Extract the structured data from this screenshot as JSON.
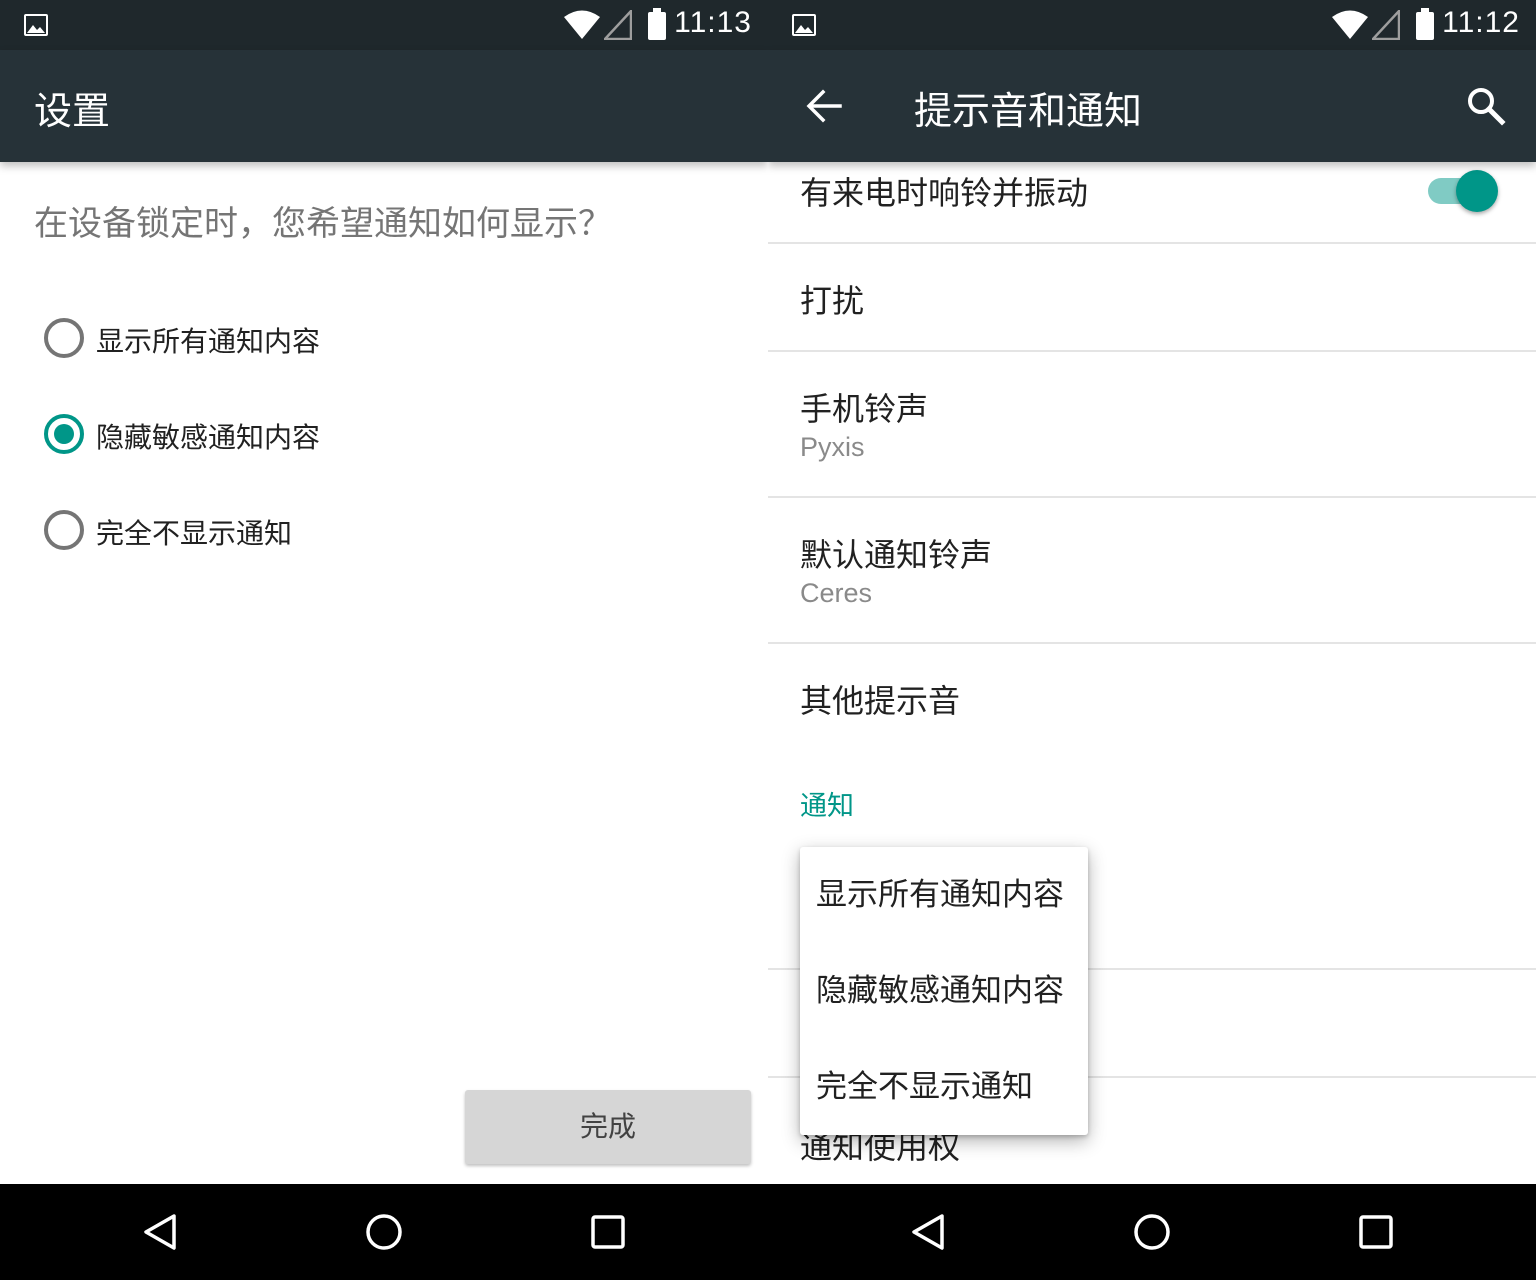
{
  "left_screen": {
    "status_bar": {
      "time": "11:13"
    },
    "toolbar": {
      "title": "设置"
    },
    "prompt": "在设备锁定时，您希望通知如何显示？",
    "options": [
      {
        "label": "显示所有通知内容",
        "checked": false
      },
      {
        "label": "隐藏敏感通知内容",
        "checked": true
      },
      {
        "label": "完全不显示通知",
        "checked": false
      }
    ],
    "done_button": "完成"
  },
  "right_screen": {
    "status_bar": {
      "time": "11:12"
    },
    "toolbar": {
      "title": "提示音和通知"
    },
    "settings": [
      {
        "label": "有来电时响铃并振动",
        "toggle_on": true
      },
      {
        "label": "打扰"
      },
      {
        "label": "手机铃声",
        "summary": "Pyxis"
      },
      {
        "label": "默认通知铃声",
        "summary": "Ceres"
      },
      {
        "label": "其他提示音"
      }
    ],
    "section_header": "通知",
    "partially_hidden_item": "通知使用权",
    "popup_menu": [
      "显示所有通知内容",
      "隐藏敏感通知内容",
      "完全不显示通知"
    ]
  },
  "colors": {
    "status_bar": "#1f282c",
    "toolbar": "#263238",
    "accent": "#009688",
    "accent_light": "#80cbc4"
  },
  "icons": [
    "image-notification-icon",
    "wifi-icon",
    "cell-signal-icon",
    "battery-icon",
    "back-arrow-icon",
    "search-icon",
    "nav-back-icon",
    "nav-home-icon",
    "nav-recents-icon"
  ]
}
